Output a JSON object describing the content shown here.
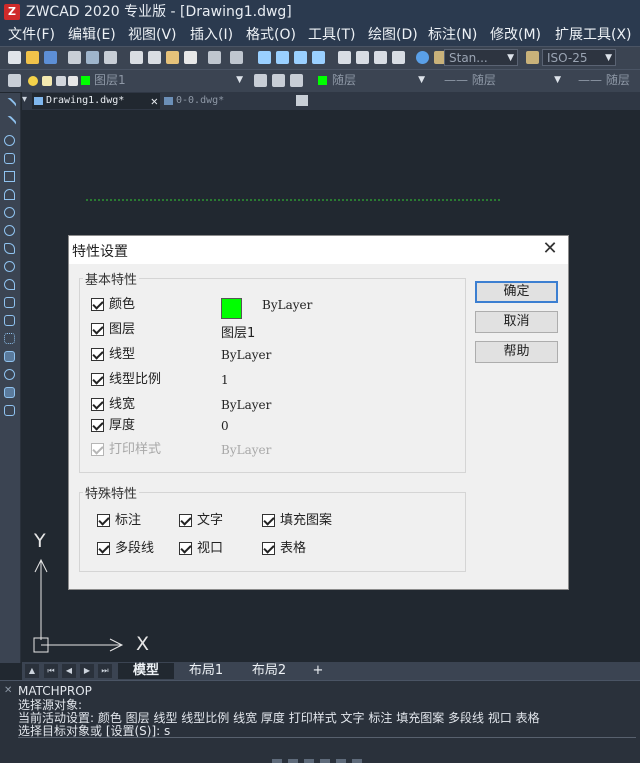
{
  "window": {
    "title": "ZWCAD 2020 专业版 - [Drawing1.dwg]"
  },
  "menu": [
    {
      "label": "文件(F)"
    },
    {
      "label": "编辑(E)"
    },
    {
      "label": "视图(V)"
    },
    {
      "label": "插入(I)"
    },
    {
      "label": "格式(O)"
    },
    {
      "label": "工具(T)"
    },
    {
      "label": "绘图(D)"
    },
    {
      "label": "标注(N)"
    },
    {
      "label": "修改(M)"
    },
    {
      "label": "扩展工具(X)"
    }
  ],
  "toolbar": {
    "text_style": "Stan...",
    "dim_style": "ISO-25",
    "layer": "图层1",
    "color": "随层",
    "linetype": "—— 随层",
    "lineweight": "—— 随层"
  },
  "doc_tabs": [
    "Drawing1.dwg*",
    "0-0.dwg*"
  ],
  "ucs": {
    "y": "Y",
    "x": "X"
  },
  "dialog": {
    "title": "特性设置",
    "close": "✕",
    "basic_group": "基本特性",
    "basic": [
      {
        "label": "颜色",
        "value": "ByLayer",
        "checked": true,
        "enabled": true
      },
      {
        "label": "图层",
        "value": "图层1",
        "checked": true,
        "enabled": true
      },
      {
        "label": "线型",
        "value": "ByLayer",
        "checked": true,
        "enabled": true
      },
      {
        "label": "线型比例",
        "value": "1",
        "checked": true,
        "enabled": true
      },
      {
        "label": "线宽",
        "value": "ByLayer",
        "checked": true,
        "enabled": true
      },
      {
        "label": "厚度",
        "value": "0",
        "checked": true,
        "enabled": true
      },
      {
        "label": "打印样式",
        "value": "ByLayer",
        "checked": true,
        "enabled": false
      }
    ],
    "color_swatch": "#00ff00",
    "special_group": "特殊特性",
    "special": [
      {
        "label": "标注"
      },
      {
        "label": "文字"
      },
      {
        "label": "填充图案"
      },
      {
        "label": "多段线"
      },
      {
        "label": "视口"
      },
      {
        "label": "表格"
      }
    ],
    "buttons": {
      "ok": "确定",
      "cancel": "取消",
      "help": "帮助"
    }
  },
  "layout_tabs": [
    "模型",
    "布局1",
    "布局2",
    "+"
  ],
  "command": {
    "lines": [
      "MATCHPROP",
      "选择源对象:",
      "当前活动设置: 颜色 图层 线型 线型比例 线宽 厚度 打印样式 文字 标注 填充图案 多段线 视口 表格",
      "选择目标对象或 [设置(S)]: s"
    ]
  }
}
